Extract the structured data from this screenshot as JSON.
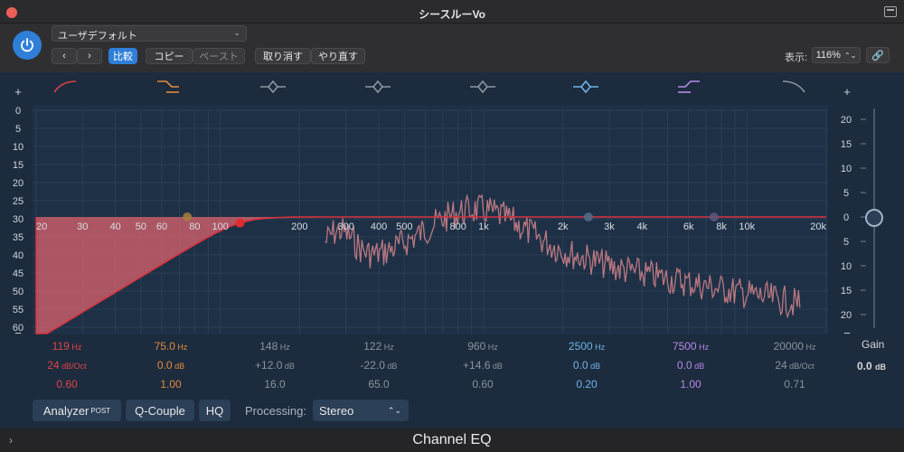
{
  "window": {
    "title": "シースルーVo"
  },
  "header": {
    "preset": "ユーザデフォルト",
    "compare": "比較",
    "copy": "コピー",
    "paste": "ペースト",
    "undo": "取り消す",
    "redo": "やり直す",
    "zoom_label": "表示:",
    "zoom_value": "116%"
  },
  "graph": {
    "db_left": [
      "0",
      "5",
      "10",
      "15",
      "20",
      "25",
      "30",
      "35",
      "40",
      "45",
      "50",
      "55",
      "60"
    ],
    "gain_right": [
      "20",
      "15",
      "10",
      "5",
      "0",
      "5",
      "10",
      "15",
      "20"
    ],
    "gain_right_ticks": [
      20,
      15,
      10,
      5,
      0,
      -5,
      -10,
      -15,
      -20
    ],
    "freq_labels": [
      "20",
      "30",
      "40",
      "50",
      "60",
      "80",
      "100",
      "200",
      "300",
      "400",
      "500",
      "800",
      "1k",
      "2k",
      "3k",
      "4k",
      "6k",
      "8k",
      "10k",
      "20k"
    ],
    "freq_values": [
      20,
      30,
      40,
      50,
      60,
      80,
      100,
      200,
      300,
      400,
      500,
      800,
      1000,
      2000,
      3000,
      4000,
      6000,
      8000,
      10000,
      20000
    ],
    "plus_left": "+",
    "minus_left": "−",
    "plus_right": "+",
    "minus_right": "−",
    "curve_color": "#d8323c",
    "fill_color": "#e86670",
    "analyzer_color": "#c97f86",
    "knob_value": "0"
  },
  "bands": [
    {
      "freq": "119",
      "freq_unit": "Hz",
      "gain": "24",
      "gain_unit": "dB/Oct",
      "q": "0.60",
      "color": "#e0434a",
      "active": true,
      "icon": "low-cut-icon"
    },
    {
      "freq": "75.0",
      "freq_unit": "Hz",
      "gain": "0.0",
      "gain_unit": "dB",
      "q": "1.00",
      "color": "#e28a3b",
      "active": true,
      "icon": "low-shelf-icon"
    },
    {
      "freq": "148",
      "freq_unit": "Hz",
      "gain": "+12.0",
      "gain_unit": "dB",
      "q": "16.0",
      "color": "#8e96a0",
      "active": false,
      "icon": "bell-icon"
    },
    {
      "freq": "122",
      "freq_unit": "Hz",
      "gain": "-22.0",
      "gain_unit": "dB",
      "q": "65.0",
      "color": "#8e96a0",
      "active": false,
      "icon": "bell-icon"
    },
    {
      "freq": "960",
      "freq_unit": "Hz",
      "gain": "+14.6",
      "gain_unit": "dB",
      "q": "0.60",
      "color": "#8e96a0",
      "active": false,
      "icon": "bell-icon"
    },
    {
      "freq": "2500",
      "freq_unit": "Hz",
      "gain": "0.0",
      "gain_unit": "dB",
      "q": "0.20",
      "color": "#6fb4e8",
      "active": true,
      "icon": "bell-icon"
    },
    {
      "freq": "7500",
      "freq_unit": "Hz",
      "gain": "0.0",
      "gain_unit": "dB",
      "q": "1.00",
      "color": "#b58ae6",
      "active": true,
      "icon": "high-shelf-icon"
    },
    {
      "freq": "20000",
      "freq_unit": "Hz",
      "gain": "24",
      "gain_unit": "dB/Oct",
      "q": "0.71",
      "color": "#8e96a0",
      "active": false,
      "icon": "high-cut-icon"
    }
  ],
  "gain_label": "Gain",
  "gain_value": "0.0",
  "gain_unit": "dB",
  "bottom": {
    "analyzer": "Analyzer",
    "analyzer_mode": "POST",
    "q_couple": "Q-Couple",
    "hq": "HQ",
    "processing_label": "Processing:",
    "processing_value": "Stereo"
  },
  "footer": {
    "plugin_name": "Channel EQ"
  }
}
